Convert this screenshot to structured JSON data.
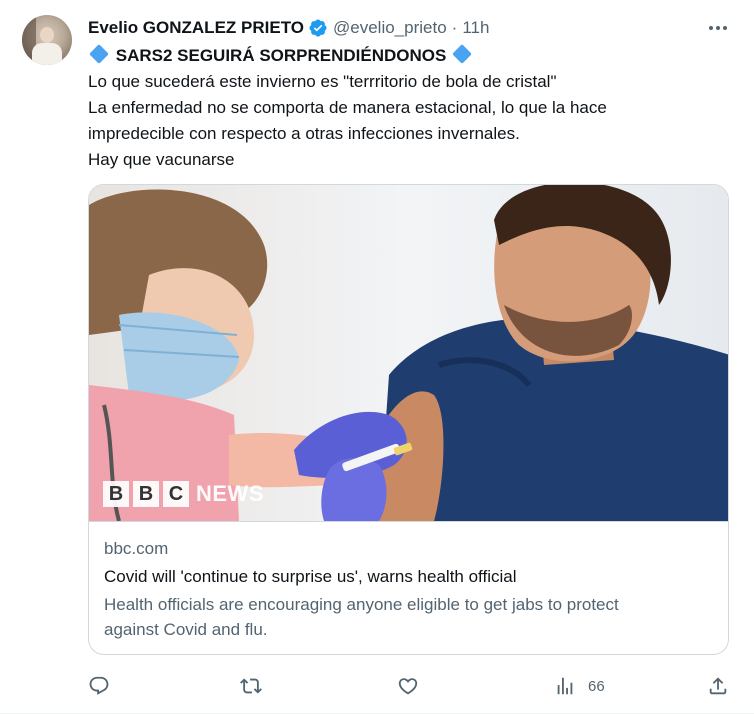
{
  "tweet": {
    "author_name": "Evelio GONZALEZ PRIETO",
    "handle": "@evelio_prieto",
    "separator": "·",
    "time": "11h",
    "headline": "SARS2 SEGUIRÁ SORPRENDIÉNDONOS",
    "lines": [
      "Lo que sucederá este invierno es \"terrritorio de bola de cristal\"",
      "La enfermedad no se comporta de manera estacional, lo que la hace",
      "impredecible con respecto a otras infecciones invernales.",
      "Hay que vacunarse"
    ]
  },
  "card": {
    "logo_letters": [
      "B",
      "B",
      "C"
    ],
    "logo_word": "NEWS",
    "domain": "bbc.com",
    "title": "Covid will 'continue to surprise us', warns health official",
    "description_lines": [
      "Health officials are encouraging anyone eligible to get jabs to protect",
      "against Covid and flu."
    ]
  },
  "actions": {
    "reply_icon": "reply-icon",
    "retweet_icon": "retweet-icon",
    "like_icon": "heart-icon",
    "views_icon": "views-icon",
    "views_count": "66",
    "share_icon": "share-icon"
  },
  "colors": {
    "accent": "#1d9bf0",
    "diamond": "#4aa3f0",
    "muted": "#536471",
    "border": "#cfd9de"
  }
}
